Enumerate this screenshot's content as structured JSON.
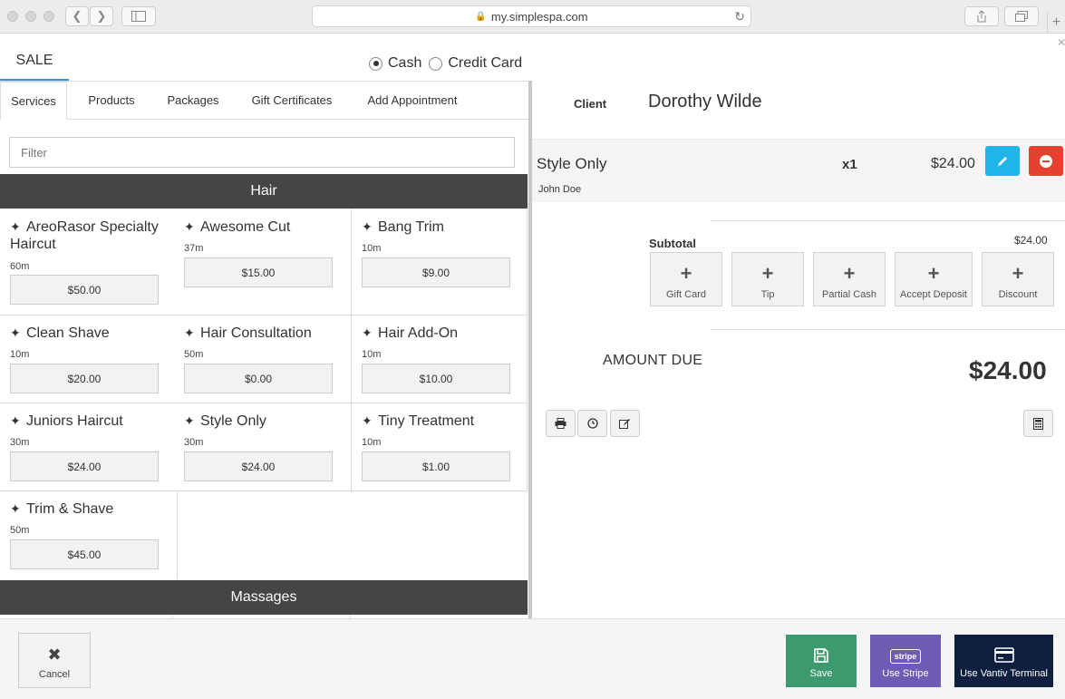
{
  "browser": {
    "url": "my.simplespa.com"
  },
  "header": {
    "sale_tab": "SALE",
    "payment_options": [
      {
        "label": "Cash",
        "selected": true
      },
      {
        "label": "Credit Card",
        "selected": false
      }
    ]
  },
  "tabs": [
    "Services",
    "Products",
    "Packages",
    "Gift Certificates",
    "Add Appointment"
  ],
  "active_tab": "Services",
  "filter": {
    "placeholder": "Filter",
    "value": ""
  },
  "categories": {
    "hair": "Hair",
    "massages": "Massages"
  },
  "services": [
    {
      "name": "AreoRasor Specialty Haircut",
      "duration": "60m",
      "price": "$50.00"
    },
    {
      "name": "Awesome Cut",
      "duration": "37m",
      "price": "$15.00"
    },
    {
      "name": "Bang Trim",
      "duration": "10m",
      "price": "$9.00"
    },
    {
      "name": "Clean Shave",
      "duration": "10m",
      "price": "$20.00"
    },
    {
      "name": "Hair Consultation",
      "duration": "50m",
      "price": "$0.00"
    },
    {
      "name": "Hair Add-On",
      "duration": "10m",
      "price": "$10.00"
    },
    {
      "name": "Juniors Haircut",
      "duration": "30m",
      "price": "$24.00"
    },
    {
      "name": "Style Only",
      "duration": "30m",
      "price": "$24.00"
    },
    {
      "name": "Tiny Treatment",
      "duration": "10m",
      "price": "$1.00"
    },
    {
      "name": "Trim & Shave",
      "duration": "50m",
      "price": "$45.00"
    }
  ],
  "ticket": {
    "client_label": "Client",
    "client_name": "Dorothy Wilde",
    "line_item": {
      "name": "Style Only",
      "staff": "John Doe",
      "qty": "x1",
      "price": "$24.00"
    },
    "subtotal_label": "Subtotal",
    "subtotal_value": "$24.00",
    "adjustments": [
      "Gift Card",
      "Tip",
      "Partial Cash",
      "Accept Deposit",
      "Discount"
    ],
    "amount_due_label": "AMOUNT DUE",
    "amount_due_value": "$24.00"
  },
  "footer": {
    "cancel": "Cancel",
    "save": "Save",
    "stripe": "Use Stripe",
    "stripe_badge": "stripe",
    "vantiv": "Use Vantiv Terminal"
  },
  "colors": {
    "accent_blue": "#3d8fd6",
    "edit_button": "#1fb5e8",
    "delete_button": "#e5412f",
    "save_button": "#3c9a6e",
    "stripe_button": "#6e5bb3",
    "vantiv_button": "#0e1f3f",
    "category_bar": "#454545"
  }
}
